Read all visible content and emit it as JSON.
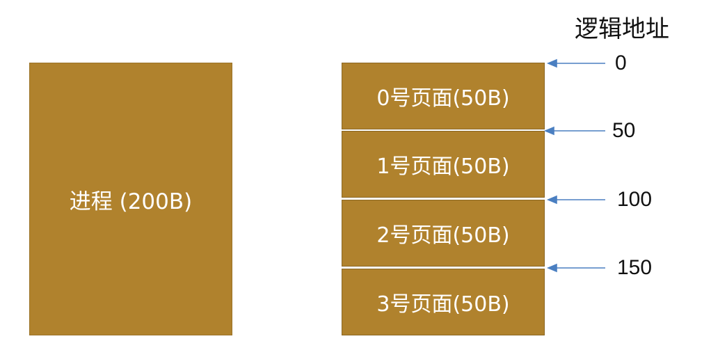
{
  "diagram": {
    "process": {
      "label": "进程 (200B)"
    },
    "pages": [
      {
        "label": "0号页面(50B)"
      },
      {
        "label": "1号页面(50B)"
      },
      {
        "label": "2号页面(50B)"
      },
      {
        "label": "3号页面(50B)"
      }
    ],
    "address_title": "逻辑地址",
    "addresses": [
      "0",
      "50",
      "100",
      "150"
    ],
    "colors": {
      "block_fill": "#b0822d",
      "block_text": "#ffffff",
      "arrow": "#4a7fc1"
    }
  }
}
